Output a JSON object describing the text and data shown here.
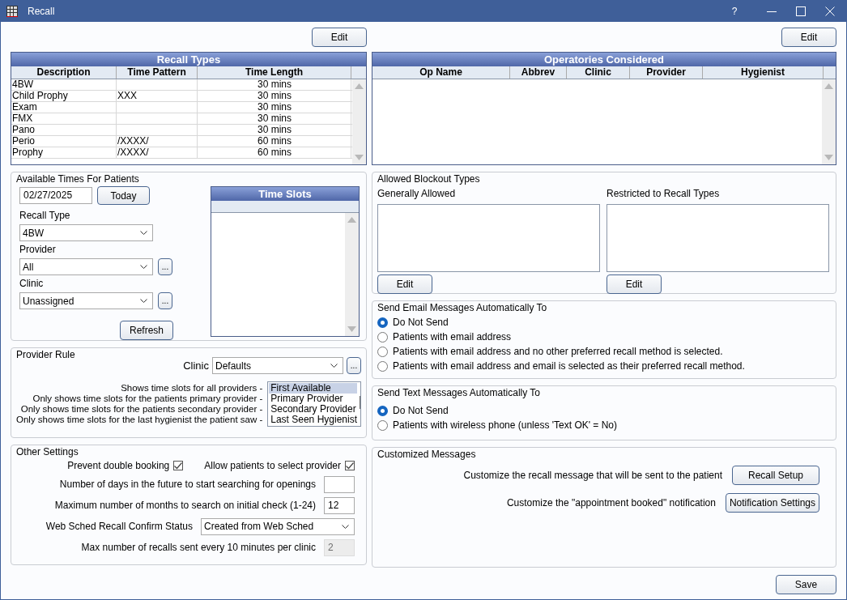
{
  "window": {
    "title": "Recall",
    "help": "?"
  },
  "recall_types": {
    "edit_button": "Edit",
    "title": "Recall Types",
    "columns": [
      "Description",
      "Time Pattern",
      "Time Length"
    ],
    "rows": [
      [
        "4BW",
        "",
        "30 mins"
      ],
      [
        "Child Prophy",
        "XXX",
        "30 mins"
      ],
      [
        "Exam",
        "",
        "30 mins"
      ],
      [
        "FMX",
        "",
        "30 mins"
      ],
      [
        "Pano",
        "",
        "30 mins"
      ],
      [
        "Perio",
        "/XXXX/",
        "60 mins"
      ],
      [
        "Prophy",
        "/XXXX/",
        "60 mins"
      ]
    ]
  },
  "operatories": {
    "edit_button": "Edit",
    "title": "Operatories Considered",
    "columns": [
      "Op Name",
      "Abbrev",
      "Clinic",
      "Provider",
      "Hygienist"
    ]
  },
  "available_times": {
    "title": "Available Times For Patients",
    "date": "02/27/2025",
    "today_button": "Today",
    "dropdowns": [
      {
        "label": "Recall Type",
        "value": "4BW",
        "has_more": false
      },
      {
        "label": "Provider",
        "value": "All",
        "has_more": true,
        "more": "..."
      },
      {
        "label": "Clinic",
        "value": "Unassigned",
        "has_more": true,
        "more": "..."
      }
    ],
    "refresh_button": "Refresh",
    "time_slots": {
      "title": "Time Slots"
    }
  },
  "provider_rule": {
    "title": "Provider Rule",
    "clinic_label": "Clinic",
    "clinic_value": "Defaults",
    "more": "...",
    "descriptions": [
      "Shows time slots for all providers -",
      "Only shows time slots for the patients primary provider -",
      "Only shows time slots for the patients secondary provider -",
      "Only shows time slots for the last hygienist the patient saw -"
    ],
    "options": [
      {
        "label": "First Available",
        "selected": true
      },
      {
        "label": "Primary Provider",
        "selected": false
      },
      {
        "label": "Secondary Provider",
        "selected": false
      },
      {
        "label": "Last Seen Hygienist",
        "selected": false
      }
    ]
  },
  "other_settings": {
    "title": "Other Settings",
    "checks": [
      {
        "label": "Prevent double booking",
        "checked": true
      },
      {
        "label": "Allow patients to select provider",
        "checked": true
      }
    ],
    "rows": [
      {
        "kind": "field",
        "label": "Number of days in the future to start searching for openings",
        "disabled": false
      },
      {
        "kind": "field",
        "label": "Maximum number of months to search on initial check (1-24)",
        "value": "12",
        "disabled": false
      },
      {
        "kind": "dropdown",
        "label": "Web Sched Recall Confirm Status",
        "value": "Created from Web Sched"
      },
      {
        "kind": "field",
        "label": "Max number of recalls sent every 10 minutes per clinic",
        "value": "2",
        "disabled": true
      }
    ]
  },
  "blockout_types": {
    "title": "Allowed Blockout Types",
    "lists": [
      {
        "label": "Generally Allowed",
        "button": "Edit"
      },
      {
        "label": "Restricted to Recall Types",
        "button": "Edit"
      }
    ]
  },
  "email": {
    "title": "Send Email Messages Automatically To",
    "options": [
      {
        "label": "Do Not Send",
        "selected": true
      },
      {
        "label": "Patients with email address",
        "selected": false
      },
      {
        "label": "Patients with email address and no other preferred recall method is selected.",
        "selected": false
      },
      {
        "label": "Patients with email address and email is selected as their preferred recall method.",
        "selected": false
      }
    ]
  },
  "text": {
    "title": "Send Text Messages Automatically To",
    "options": [
      {
        "label": "Do Not Send",
        "selected": true
      },
      {
        "label": "Patients with wireless phone (unless 'Text OK' = No)",
        "selected": false
      }
    ]
  },
  "customized": {
    "title": "Customized Messages",
    "rows": [
      {
        "label": "Customize the recall message that will be sent to the patient",
        "button": "Recall Setup"
      },
      {
        "label": "Customize the \"appointment booked\" notification",
        "button": "Notification Settings"
      }
    ]
  },
  "save_button": "Save"
}
